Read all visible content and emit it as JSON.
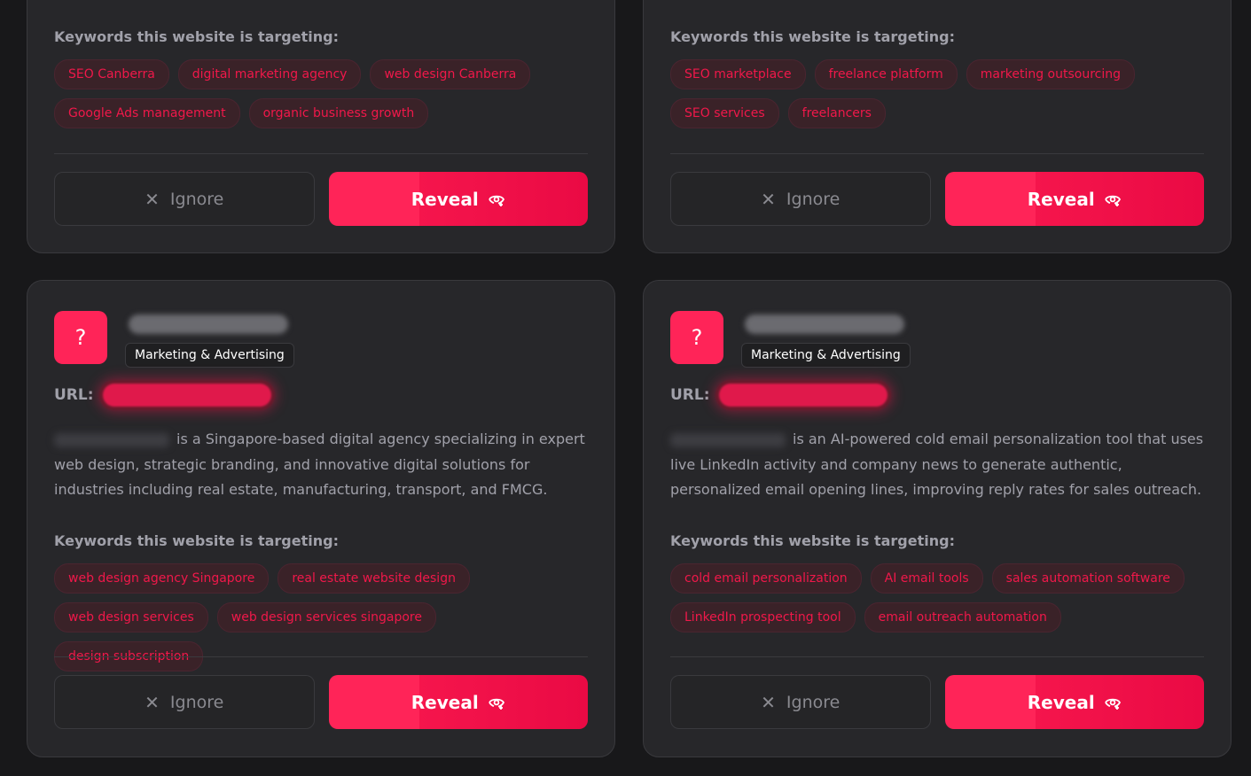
{
  "labels": {
    "keywords_title": "Keywords this website is targeting:",
    "ignore": "Ignore",
    "reveal": "Reveal",
    "url": "URL:",
    "avatar": "?"
  },
  "cards": [
    {
      "keywords": [
        "SEO Canberra",
        "digital marketing agency",
        "web design Canberra",
        "Google Ads management",
        "organic business growth"
      ]
    },
    {
      "keywords": [
        "SEO marketplace",
        "freelance platform",
        "marketing outsourcing",
        "SEO services",
        "freelancers"
      ]
    },
    {
      "category": "Marketing & Advertising",
      "description": "is a Singapore-based digital agency specializing in expert web design, strategic branding, and innovative digital solutions for industries including real estate, manufacturing, transport, and FMCG.",
      "keywords": [
        "web design agency Singapore",
        "real estate website design",
        "web design services",
        "web design services singapore",
        "design subscription"
      ]
    },
    {
      "category": "Marketing & Advertising",
      "description": "is an AI-powered cold email personalization tool that uses live LinkedIn activity and company news to generate authentic, personalized email opening lines, improving reply rates for sales outreach.",
      "keywords": [
        "cold email personalization",
        "AI email tools",
        "sales automation software",
        "LinkedIn prospecting tool",
        "email outreach automation"
      ]
    }
  ],
  "colors": {
    "accent": "#ff2458",
    "chip_text": "#f0184a",
    "card_bg": "#27272a",
    "page_bg": "#18181a"
  }
}
